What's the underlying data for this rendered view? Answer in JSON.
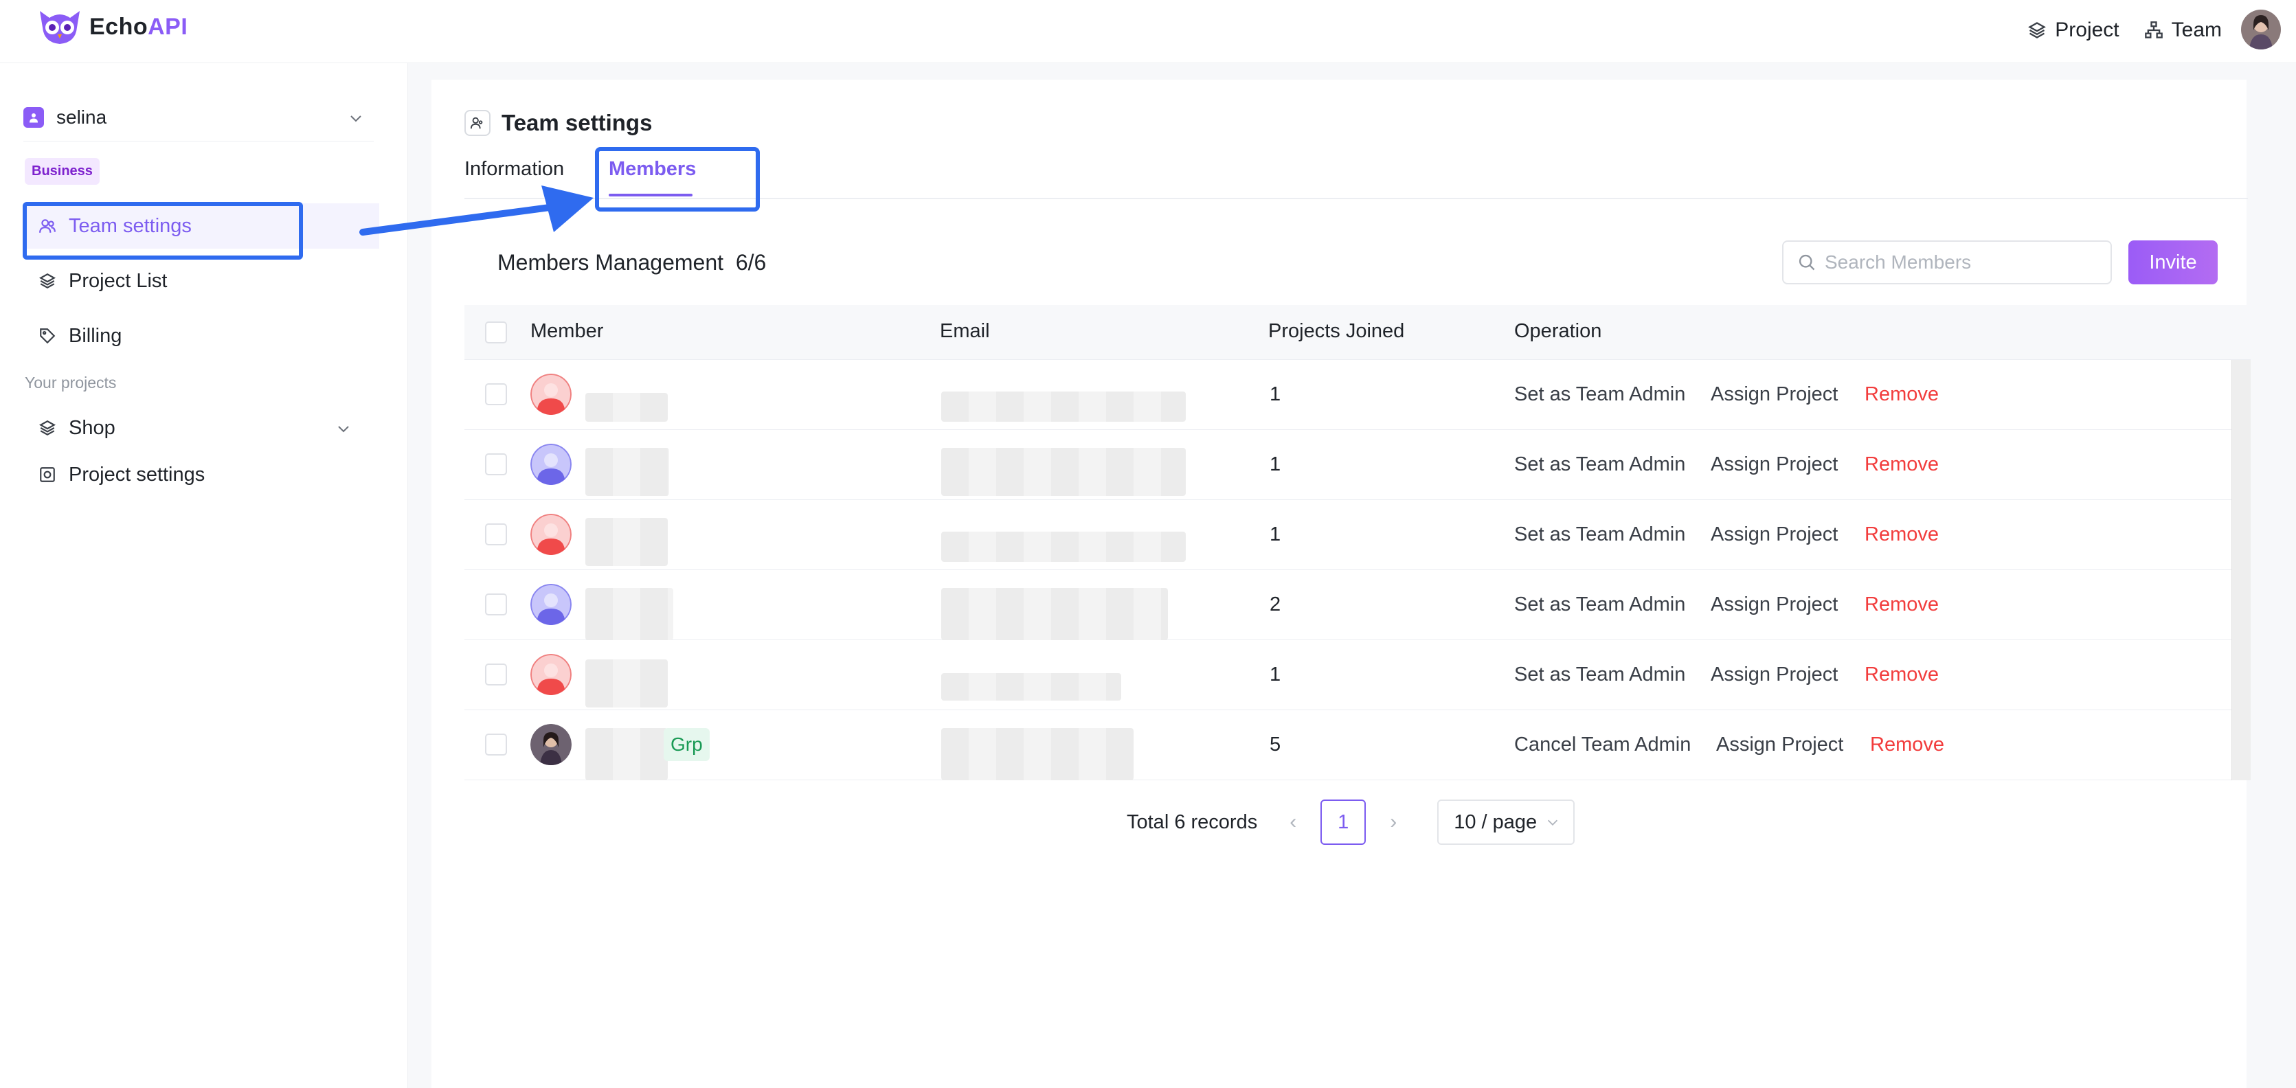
{
  "app": {
    "logo_echo": "Echo",
    "logo_api": "API",
    "accent_color": "#7c5cf0",
    "remove_color": "#f23c3c"
  },
  "top_nav": {
    "project_label": "Project",
    "team_label": "Team"
  },
  "sidebar": {
    "workspace_name": "selina",
    "plan_badge": "Business",
    "items": [
      {
        "label": "Team settings",
        "icon": "team-icon"
      },
      {
        "label": "Project List",
        "icon": "layers-icon"
      },
      {
        "label": "Billing",
        "icon": "tag-icon"
      }
    ],
    "section_label": "Your projects",
    "project_items": [
      {
        "label": "Shop",
        "icon": "layers-icon"
      },
      {
        "label": "Project settings",
        "icon": "settings-square-icon"
      }
    ]
  },
  "page": {
    "title": "Team settings",
    "tabs": [
      {
        "label": "Information"
      },
      {
        "label": "Members"
      }
    ]
  },
  "members": {
    "heading": "Members Management",
    "count": "6/6",
    "search_placeholder": "Search Members",
    "invite_label": "Invite",
    "columns": [
      "Member",
      "Email",
      "Projects Joined",
      "Operation"
    ],
    "rows": [
      {
        "projects": "1",
        "admin_action": "Set as Team Admin",
        "assign": "Assign Project",
        "remove": "Remove",
        "avatar": "red"
      },
      {
        "projects": "1",
        "admin_action": "Set as Team Admin",
        "assign": "Assign Project",
        "remove": "Remove",
        "avatar": "purple"
      },
      {
        "projects": "1",
        "admin_action": "Set as Team Admin",
        "assign": "Assign Project",
        "remove": "Remove",
        "avatar": "red"
      },
      {
        "projects": "2",
        "admin_action": "Set as Team Admin",
        "assign": "Assign Project",
        "remove": "Remove",
        "avatar": "purple"
      },
      {
        "projects": "1",
        "admin_action": "Set as Team Admin",
        "assign": "Assign Project",
        "remove": "Remove",
        "avatar": "red"
      },
      {
        "projects": "5",
        "admin_action": "Cancel Team Admin",
        "assign": "Assign Project",
        "remove": "Remove",
        "avatar": "photo",
        "tag": "Grp"
      }
    ]
  },
  "pagination": {
    "total": "Total 6 records",
    "current_page": "1",
    "page_size": "10 / page"
  }
}
